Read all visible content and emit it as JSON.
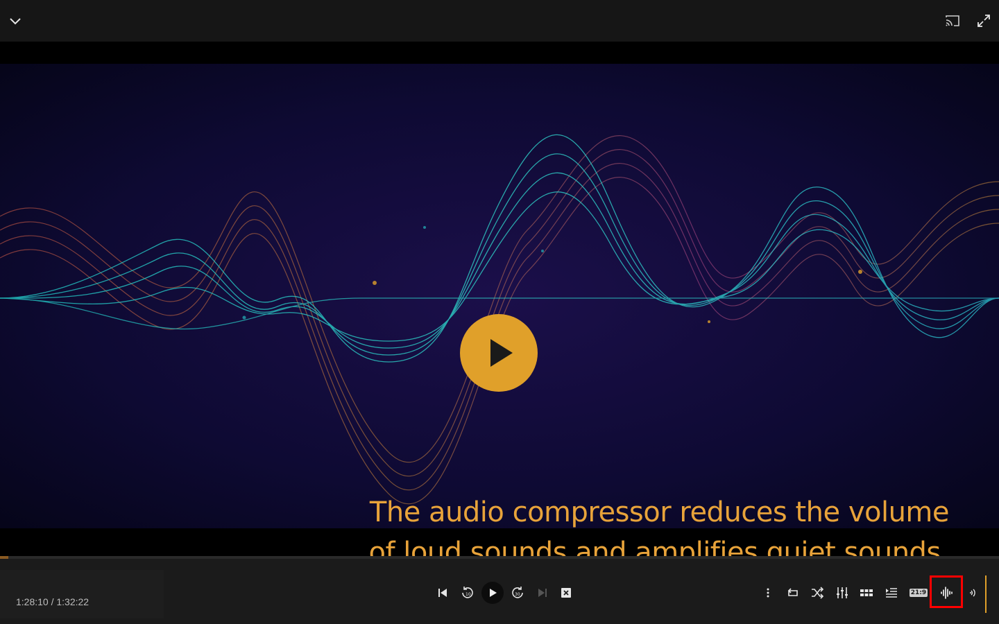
{
  "app": {
    "caption_lines": [
      "The audio compressor reduces the volume",
      "of loud sounds and amplifies quiet sounds."
    ]
  },
  "player": {
    "time_display": "1:28:10 / 1:32:22",
    "elapsed": "1:28:10",
    "duration": "1:32:22",
    "progress_fraction": 0.0,
    "aspect_ratio_label": "21:9",
    "accent_color": "#e0a02a",
    "caption_color": "#e8a33a",
    "highlight_color": "#ff0000"
  },
  "icons": {
    "top": [
      "chevron-down-icon",
      "cast-icon",
      "fullscreen-icon"
    ],
    "center": [
      "skip-previous-icon",
      "rewind-10-icon",
      "play-icon",
      "forward-30-icon",
      "skip-next-icon",
      "stop-icon"
    ],
    "right": [
      "more-vertical-icon",
      "repeat-icon",
      "shuffle-icon",
      "equalizer-icon",
      "grid-view-icon",
      "playlist-icon",
      "aspect-ratio-icon",
      "audio-compressor-icon",
      "volume-icon"
    ]
  }
}
